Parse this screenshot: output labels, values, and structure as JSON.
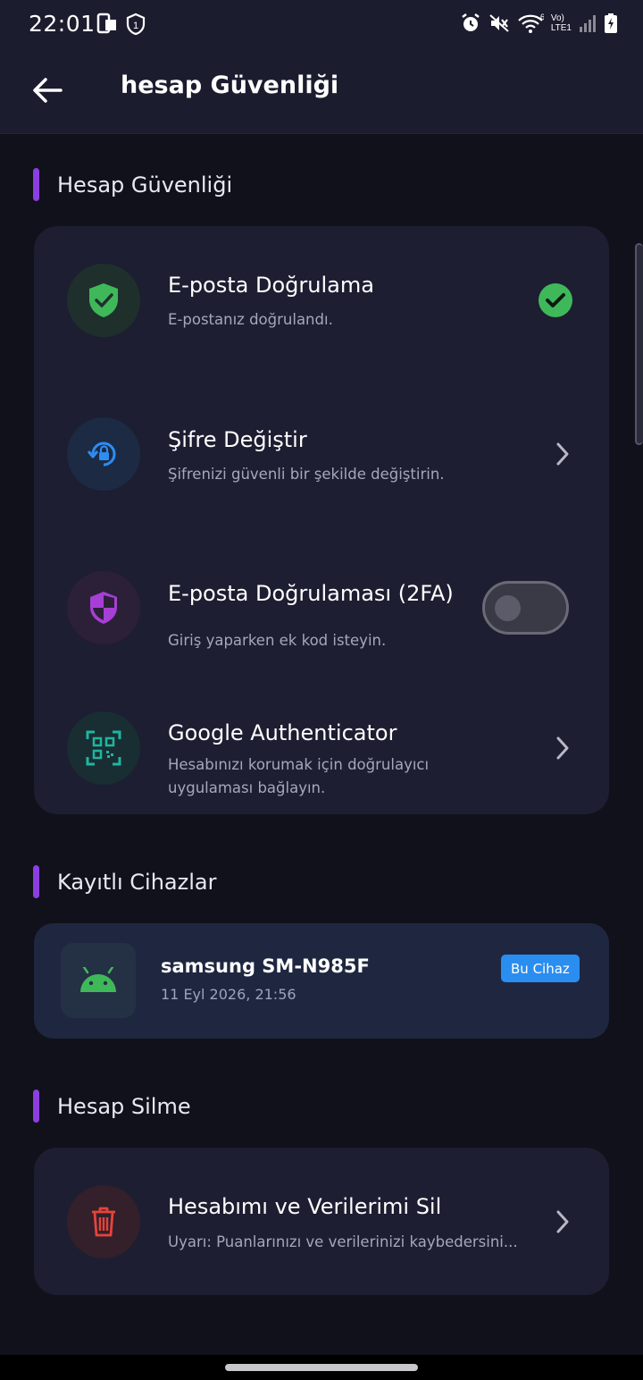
{
  "status_bar": {
    "time": "22:01",
    "network_label_top": "Vo)",
    "network_label_bottom": "LTE1",
    "wifi_label": "6"
  },
  "app_bar": {
    "title": "hesap Güvenliği",
    "back_icon": "arrow-left-icon"
  },
  "sections": {
    "security": {
      "label": "Hesap Güvenliği",
      "items": [
        {
          "title": "E-posta Doğrulama",
          "subtitle": "E-postanız doğrulandı.",
          "icon": "shield-check-icon",
          "trailing": "check-circle-icon",
          "icon_color": "#3fb85a"
        },
        {
          "title": "Şifre Değiştir",
          "subtitle": "Şifrenizi güvenli bir şekilde değiştirin.",
          "icon": "lock-reset-icon",
          "trailing": "chevron-right-icon",
          "icon_color": "#2f8cf0"
        },
        {
          "title": "E-posta Doğrulaması (2FA)",
          "subtitle": "Giriş yaparken ek kod isteyin.",
          "icon": "shield-half-icon",
          "trailing": "toggle-switch",
          "toggle_on": false,
          "icon_color": "#a63fd6"
        },
        {
          "title": "Google Authenticator",
          "subtitle": "Hesabınızı korumak için doğrulayıcı uygulaması bağlayın.",
          "icon": "qr-scan-icon",
          "trailing": "chevron-right-icon",
          "icon_color": "#1fb5a0"
        }
      ]
    },
    "devices": {
      "label": "Kayıtlı Cihazlar",
      "items": [
        {
          "name": "samsung SM-N985F",
          "date": "11 Eyl 2026, 21:56",
          "badge": "Bu Cihaz",
          "icon": "android-icon"
        }
      ]
    },
    "delete": {
      "label": "Hesap Silme",
      "item": {
        "title": "Hesabımı ve Verilerimi Sil",
        "subtitle": "Uyarı: Puanlarınızı ve verilerinizi kaybedersini...",
        "icon": "trash-icon",
        "trailing": "chevron-right-icon",
        "icon_color": "#e5443a"
      }
    }
  },
  "colors": {
    "accent": "#8b3fe0",
    "background": "#11111b",
    "card": "#1d1e31",
    "badge": "#2a8df0",
    "success": "#3fb85a",
    "danger": "#e5443a"
  }
}
